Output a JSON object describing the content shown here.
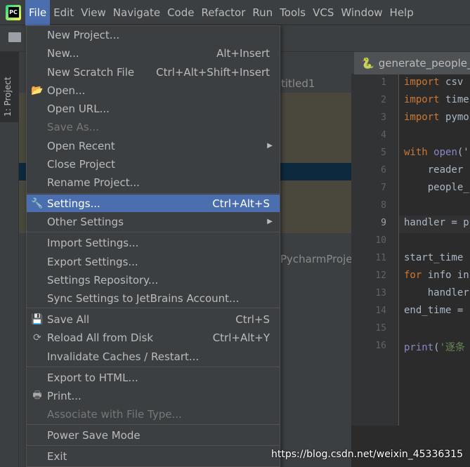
{
  "menubar": {
    "logo": "PC",
    "items": [
      "File",
      "Edit",
      "View",
      "Navigate",
      "Code",
      "Refactor",
      "Run",
      "Tools",
      "VCS",
      "Window",
      "Help"
    ],
    "active": "File"
  },
  "toolwindow": {
    "tab": "1: Project",
    "project_name": "titled1",
    "path_text": "PycharmProje"
  },
  "editor": {
    "tab": "generate_people_i",
    "lines": [
      "1",
      "2",
      "3",
      "4",
      "5",
      "6",
      "7",
      "8",
      "9",
      "10",
      "11",
      "12",
      "13",
      "14",
      "15",
      "16"
    ],
    "code": [
      [
        [
          "kw",
          "import"
        ],
        [
          "",
          "csv"
        ]
      ],
      [
        [
          "kw",
          "import"
        ],
        [
          "",
          "time"
        ]
      ],
      [
        [
          "kw",
          "import"
        ],
        [
          "",
          "pymo"
        ]
      ],
      [],
      [
        [
          "kw",
          "with"
        ],
        [
          "fn",
          "open"
        ],
        [
          "",
          "('"
        ]
      ],
      [
        [
          "",
          "    reader"
        ]
      ],
      [
        [
          "",
          "    people_"
        ]
      ],
      [],
      [
        [
          "",
          "handler = p"
        ]
      ],
      [],
      [
        [
          "",
          "start_time"
        ]
      ],
      [
        [
          "kw",
          "for"
        ],
        [
          "",
          "info in"
        ]
      ],
      [
        [
          "",
          "    handler"
        ]
      ],
      [
        [
          "",
          "end_time ="
        ]
      ],
      [],
      [
        [
          "fn",
          "print"
        ],
        [
          "",
          "("
        ],
        [
          "st",
          "'逐条"
        ]
      ]
    ]
  },
  "file_menu": {
    "items": [
      {
        "label": "New Project...",
        "shortcut": ""
      },
      {
        "label": "New...",
        "shortcut": "Alt+Insert"
      },
      {
        "label": "New Scratch File",
        "shortcut": "Ctrl+Alt+Shift+Insert"
      },
      {
        "label": "Open...",
        "shortcut": "",
        "icon": "folder-open-icon"
      },
      {
        "label": "Open URL...",
        "shortcut": ""
      },
      {
        "label": "Save As...",
        "shortcut": "",
        "disabled": true
      },
      {
        "label": "Open Recent",
        "shortcut": "",
        "submenu": true
      },
      {
        "label": "Close Project",
        "shortcut": ""
      },
      {
        "label": "Rename Project...",
        "shortcut": ""
      },
      {
        "label": "Settings...",
        "shortcut": "Ctrl+Alt+S",
        "icon": "wrench-icon",
        "highlighted": true
      },
      {
        "label": "Other Settings",
        "shortcut": "",
        "submenu": true
      },
      {
        "label": "Import Settings...",
        "shortcut": ""
      },
      {
        "label": "Export Settings...",
        "shortcut": ""
      },
      {
        "label": "Settings Repository...",
        "shortcut": ""
      },
      {
        "label": "Sync Settings to JetBrains Account...",
        "shortcut": ""
      },
      {
        "label": "Save All",
        "shortcut": "Ctrl+S",
        "icon": "save-icon"
      },
      {
        "label": "Reload All from Disk",
        "shortcut": "Ctrl+Alt+Y",
        "icon": "reload-icon"
      },
      {
        "label": "Invalidate Caches / Restart...",
        "shortcut": ""
      },
      {
        "label": "Export to HTML...",
        "shortcut": ""
      },
      {
        "label": "Print...",
        "shortcut": "",
        "icon": "printer-icon"
      },
      {
        "label": "Associate with File Type...",
        "shortcut": "",
        "disabled": true
      },
      {
        "label": "Power Save Mode",
        "shortcut": ""
      },
      {
        "label": "Exit",
        "shortcut": ""
      }
    ]
  },
  "watermark": "https://blog.csdn.net/weixin_45336315",
  "colors": {
    "highlight": "#4b6eaf",
    "keyword": "#cc7832",
    "builtin": "#8888c6",
    "string": "#6a8759"
  }
}
